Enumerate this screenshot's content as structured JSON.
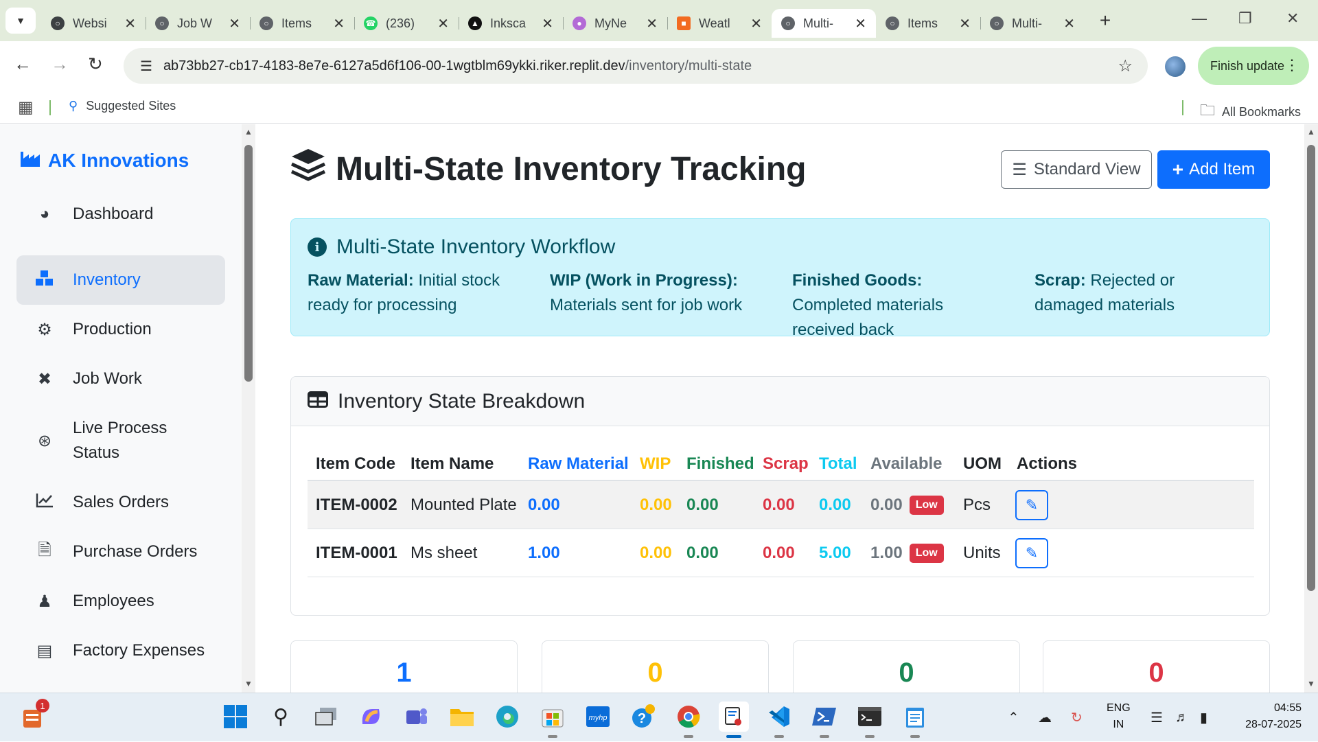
{
  "browser": {
    "tabs": [
      {
        "title": "Websi",
        "icon": "globe-icon"
      },
      {
        "title": "Job W",
        "icon": "globe-icon"
      },
      {
        "title": "Items",
        "icon": "globe-icon"
      },
      {
        "title": "(236)",
        "icon": "whatsapp-icon"
      },
      {
        "title": "Inksca",
        "icon": "inkscape-icon"
      },
      {
        "title": "MyNe",
        "icon": "mynetwork-icon"
      },
      {
        "title": "Weatl",
        "icon": "weather-icon"
      },
      {
        "title": "Multi-",
        "icon": "globe-icon",
        "active": true
      },
      {
        "title": "Items",
        "icon": "globe-icon"
      },
      {
        "title": "Multi-",
        "icon": "globe-icon"
      }
    ],
    "url_host": "ab73bb27-cb17-4183-8e7e-6127a5d6f106-00-1wgtblm69ykki.riker.replit.dev",
    "url_path": "/inventory/multi-state",
    "finish_update": "Finish update",
    "bookmarks": {
      "suggested": "Suggested Sites",
      "all": "All Bookmarks"
    }
  },
  "sidebar": {
    "brand": "AK Innovations",
    "items": [
      {
        "label": "Dashboard",
        "icon": "gauge-icon"
      },
      {
        "label": "Inventory",
        "icon": "boxes-icon",
        "active": true
      },
      {
        "label": "Production",
        "icon": "cogs-icon"
      },
      {
        "label": "Job Work",
        "icon": "tools-icon"
      },
      {
        "label": "Live Process Status",
        "icon": "broadcast-icon"
      },
      {
        "label": "Sales Orders",
        "icon": "chart-line-icon"
      },
      {
        "label": "Purchase Orders",
        "icon": "file-icon"
      },
      {
        "label": "Employees",
        "icon": "users-icon"
      },
      {
        "label": "Factory Expenses",
        "icon": "receipt-icon"
      }
    ]
  },
  "header": {
    "title": "Multi-State Inventory Tracking",
    "standard_view": "Standard View",
    "add_item": "Add Item"
  },
  "workflow": {
    "title": "Multi-State Inventory Workflow",
    "states": [
      {
        "name": "Raw Material:",
        "desc": "Initial stock ready for processing"
      },
      {
        "name": "WIP (Work in Progress):",
        "desc": "Materials sent for job work"
      },
      {
        "name": "Finished Goods:",
        "desc": "Completed materials received back"
      },
      {
        "name": "Scrap:",
        "desc": "Rejected or damaged materials"
      }
    ]
  },
  "breakdown": {
    "title": "Inventory State Breakdown",
    "columns": [
      "Item Code",
      "Item Name",
      "Raw Material",
      "WIP",
      "Finished",
      "Scrap",
      "Total",
      "Available",
      "UOM",
      "Actions"
    ],
    "rows": [
      {
        "code": "ITEM-0002",
        "name": "Mounted Plate",
        "raw": "0.00",
        "wip": "0.00",
        "finished": "0.00",
        "scrap": "0.00",
        "total": "0.00",
        "available": "0.00",
        "badge": "Low",
        "uom": "Pcs"
      },
      {
        "code": "ITEM-0001",
        "name": "Ms sheet",
        "raw": "1.00",
        "wip": "0.00",
        "finished": "0.00",
        "scrap": "0.00",
        "total": "5.00",
        "available": "1.00",
        "badge": "Low",
        "uom": "Units"
      }
    ]
  },
  "stats": [
    "1",
    "0",
    "0",
    "0"
  ],
  "colors": {
    "primary": "#0d6efd",
    "warning": "#ffc107",
    "success": "#198754",
    "danger": "#dc3545",
    "info": "#0dcaf0",
    "muted": "#6c757d"
  },
  "taskbar": {
    "lang1": "ENG",
    "lang2": "IN",
    "time": "04:55",
    "date": "28-07-2025",
    "notification_count": "1"
  }
}
